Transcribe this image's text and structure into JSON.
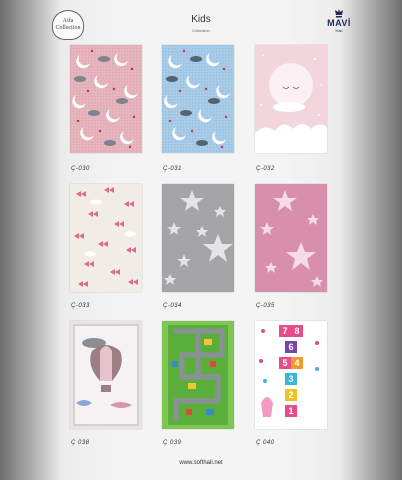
{
  "header": {
    "left_logo_text": "Aifa Collection",
    "title": "Kids",
    "subtitle": "Collection",
    "brand": "MAVİ",
    "brand_sub": "Halı"
  },
  "products": [
    {
      "code": "Ç-030",
      "pattern": "pink moon clouds"
    },
    {
      "code": "Ç-031",
      "pattern": "blue moon clouds"
    },
    {
      "code": "Ç-032",
      "pattern": "pink big moon"
    },
    {
      "code": "Ç-033",
      "pattern": "pink butterflies"
    },
    {
      "code": "Ç-034",
      "pattern": "grey stars"
    },
    {
      "code": "Ç-035",
      "pattern": "pink stars"
    },
    {
      "code": "Ç 038",
      "pattern": "hot air balloon"
    },
    {
      "code": "Ç 039",
      "pattern": "road map"
    },
    {
      "code": "Ç 040",
      "pattern": "hopscotch"
    }
  ],
  "footer": {
    "website": "www.softhali.net"
  },
  "colors": {
    "pink": "#e7b7c0",
    "blue": "#a9cde8",
    "grey": "#a9a9a9",
    "rose": "#d98fab"
  }
}
